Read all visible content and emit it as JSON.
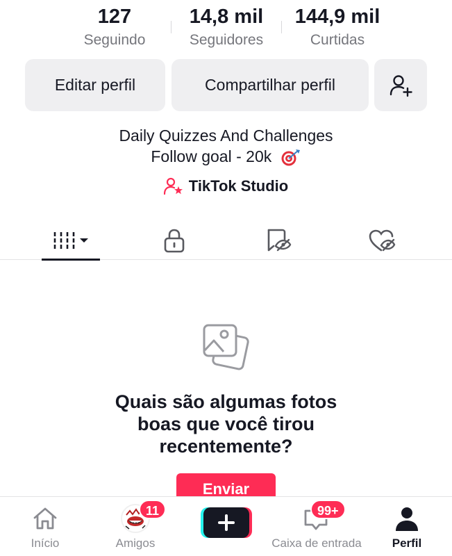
{
  "stats": {
    "following": {
      "value": "127",
      "label": "Seguindo"
    },
    "followers": {
      "value": "14,8 mil",
      "label": "Seguidores"
    },
    "likes": {
      "value": "144,9 mil",
      "label": "Curtidas"
    }
  },
  "actions": {
    "edit_profile": "Editar perfil",
    "share_profile": "Compartilhar perfil",
    "add_friend_icon": "add-person-icon"
  },
  "bio": {
    "line1": "Daily Quizzes And Challenges",
    "line2": "Follow goal - 20k",
    "emoji": "target-icon"
  },
  "studio_link": "TikTok Studio",
  "tabs": [
    {
      "name": "videos",
      "icon": "grid-icon",
      "active": true
    },
    {
      "name": "private",
      "icon": "lock-icon"
    },
    {
      "name": "reposts",
      "icon": "repost-hidden-icon"
    },
    {
      "name": "liked",
      "icon": "heart-hidden-icon"
    }
  ],
  "empty_state": {
    "line1": "Quais são algumas fotos",
    "line2": "boas que você tirou",
    "line3": "recentemente?",
    "button": "Enviar"
  },
  "bottom_nav": {
    "home": "Início",
    "friends": "Amigos",
    "friends_badge": "11",
    "inbox": "Caixa de entrada",
    "inbox_badge": "99+",
    "profile": "Perfil"
  },
  "colors": {
    "accent": "#fe2c55",
    "text": "#161823",
    "muted": "#75767c",
    "button_bg": "#efeff1"
  }
}
